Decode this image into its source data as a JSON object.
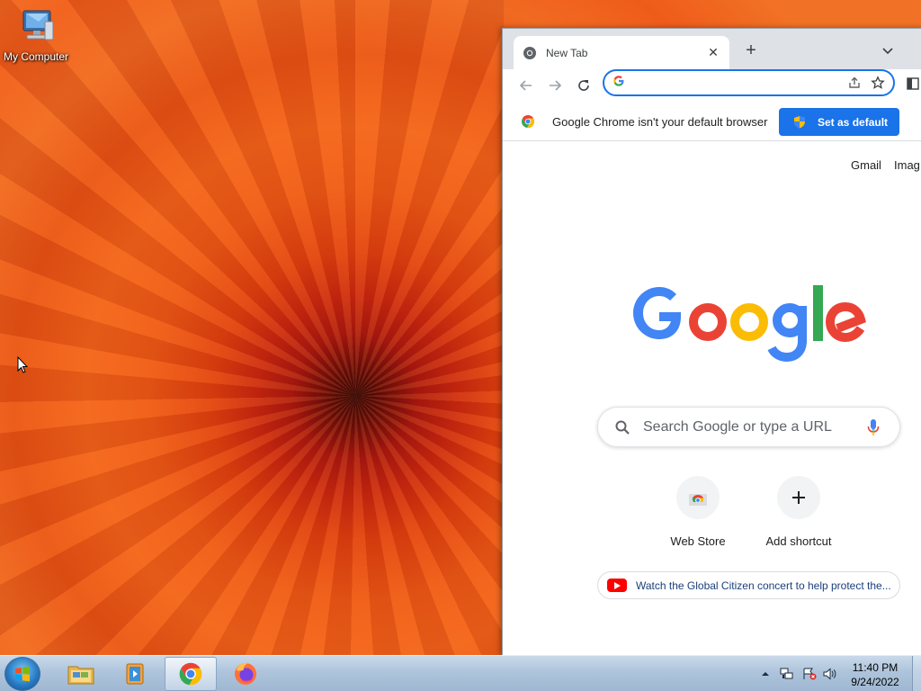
{
  "desktop": {
    "icons": [
      {
        "label": "My Computer",
        "icon": "computer-icon"
      }
    ]
  },
  "browser": {
    "tab": {
      "title": "New Tab",
      "icon": "chrome-icon"
    },
    "omnibox": {
      "value": "",
      "placeholder": ""
    },
    "infobar": {
      "message": "Google Chrome isn't your default browser",
      "button_label": "Set as default"
    },
    "ntp": {
      "top_links": [
        "Gmail",
        "Imag"
      ],
      "logo_text": "Google",
      "search_placeholder": "Search Google or type a URL",
      "shortcuts": [
        {
          "label": "Web Store",
          "icon": "web-store-icon"
        },
        {
          "label": "Add shortcut",
          "icon": "plus-icon"
        }
      ],
      "promo_text": "Watch the Global Citizen concert to help protect the..."
    }
  },
  "taskbar": {
    "pinned": [
      "file-explorer-icon",
      "media-player-icon",
      "chrome-icon",
      "firefox-icon"
    ],
    "active": "chrome-icon",
    "tray_icons": [
      "show-hidden-icon",
      "network-icon",
      "action-center-icon",
      "volume-icon"
    ],
    "clock": {
      "time": "11:40 PM",
      "date": "9/24/2022"
    }
  },
  "colors": {
    "accent": "#1a73e8",
    "google_blue": "#4285f4",
    "google_red": "#ea4335",
    "google_yellow": "#fbbc05",
    "google_green": "#34a853",
    "wallpaper": "#f05a1a"
  }
}
